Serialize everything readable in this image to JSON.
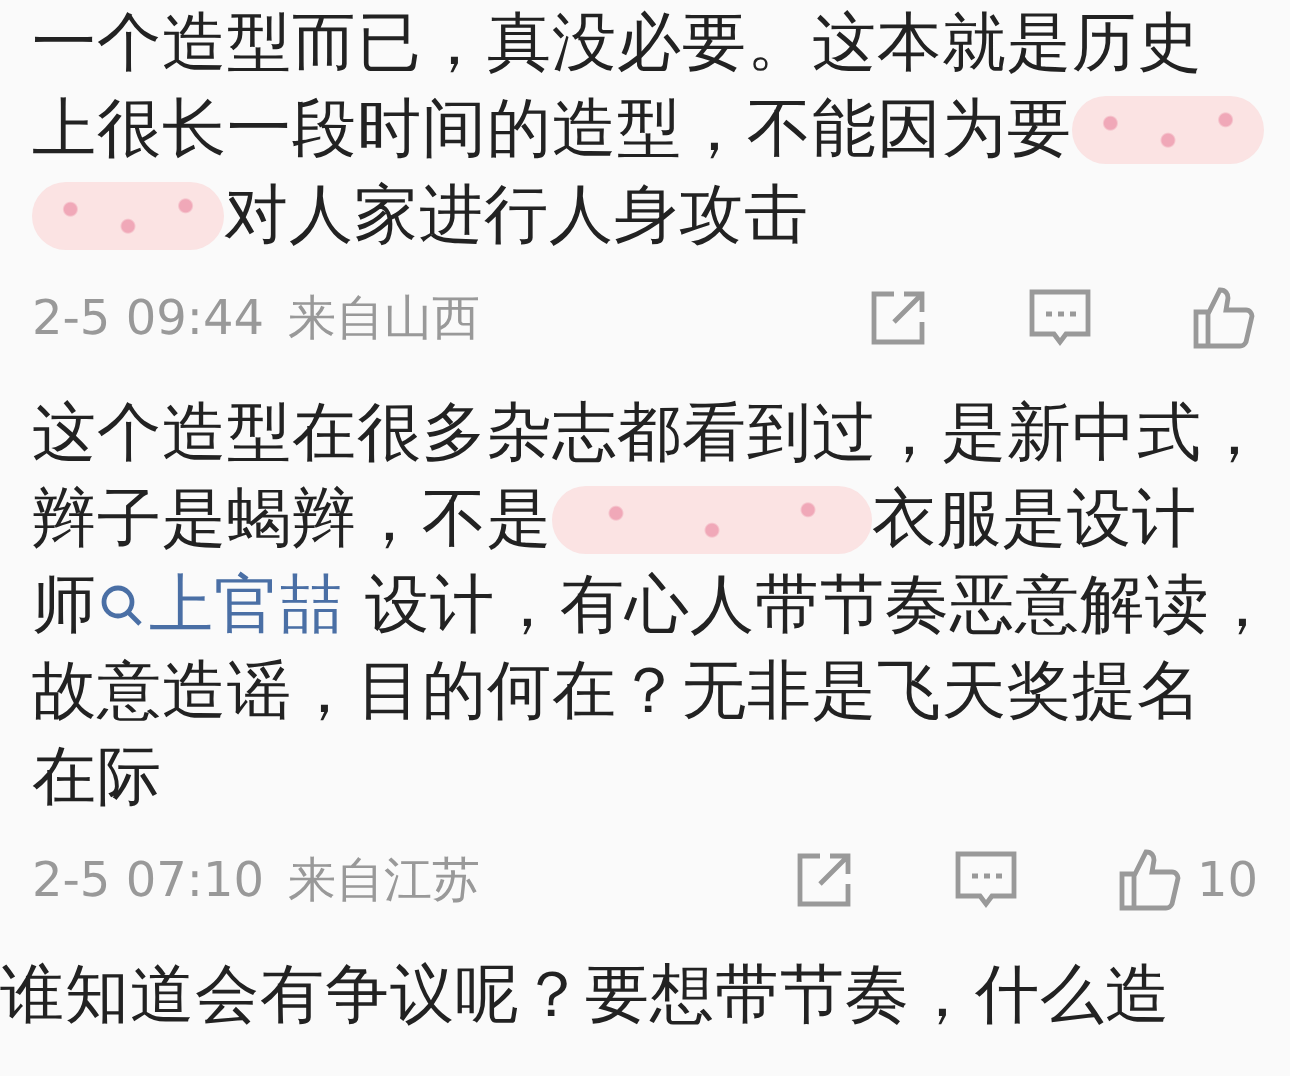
{
  "comments": [
    {
      "lines": [
        [
          {
            "kind": "text",
            "text": "一个造型而已，真没必要。这本就是历史"
          }
        ],
        [
          {
            "kind": "text",
            "text": "上很长一段时间的造型，不能因为要"
          },
          {
            "kind": "mask_short"
          }
        ],
        [
          {
            "kind": "mask_short"
          },
          {
            "kind": "text",
            "text": "对人家进行人身攻击"
          }
        ]
      ],
      "meta": {
        "time": "2-5 09:44",
        "location": "来自山西"
      }
    },
    {
      "lines": [
        [
          {
            "kind": "text",
            "text": "这个造型在很多杂志都看到过，是新中式，"
          }
        ],
        [
          {
            "kind": "text",
            "text": "辫子是蝎辫，不是"
          },
          {
            "kind": "mask_long"
          },
          {
            "kind": "text",
            "text": "衣服是设计"
          }
        ],
        [
          {
            "kind": "text",
            "text": "师"
          },
          {
            "kind": "mention",
            "text": "上官喆"
          },
          {
            "kind": "text",
            "text": " 设计，有心人带节奏恶意解读，"
          }
        ],
        [
          {
            "kind": "text",
            "text": "故意造谣，目的何在？无非是飞天奖提名"
          }
        ],
        [
          {
            "kind": "text",
            "text": "在际"
          }
        ]
      ],
      "meta": {
        "time": "2-5 07:10",
        "location": "来自江苏",
        "likes": "10"
      }
    },
    {
      "lines": [
        [
          {
            "kind": "text",
            "text": "谁知道会有争议呢？要想带节奏，什么造"
          }
        ]
      ]
    }
  ]
}
